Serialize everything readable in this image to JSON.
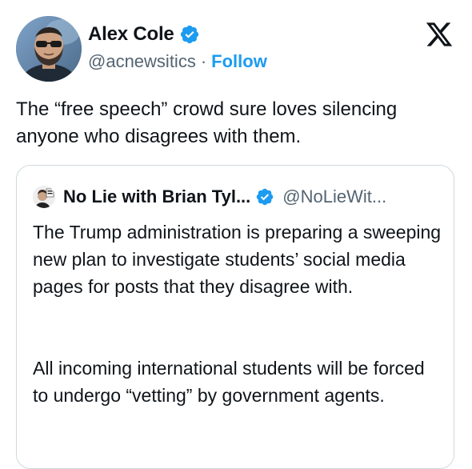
{
  "author": {
    "display_name": "Alex Cole",
    "handle": "@acnewsitics",
    "separator": "·",
    "follow_label": "Follow",
    "verified": true
  },
  "brand": {
    "icon": "x-logo-icon"
  },
  "tweet": {
    "text": "The “free speech” crowd sure loves silencing anyone who disagrees with them."
  },
  "quoted": {
    "display_name": "No Lie with Brian Tyl...",
    "handle": "@NoLieWit...",
    "verified": true,
    "paragraph_1": "The Trump administration is preparing a sweeping new plan to investigate students’ social media pages for posts that they disagree with.",
    "paragraph_2": "All incoming international students will be forced to undergo “vetting” by government agents."
  },
  "colors": {
    "accent": "#1d9bf0",
    "text": "#0f1419",
    "secondary": "#536471",
    "border": "#cfd9de"
  }
}
